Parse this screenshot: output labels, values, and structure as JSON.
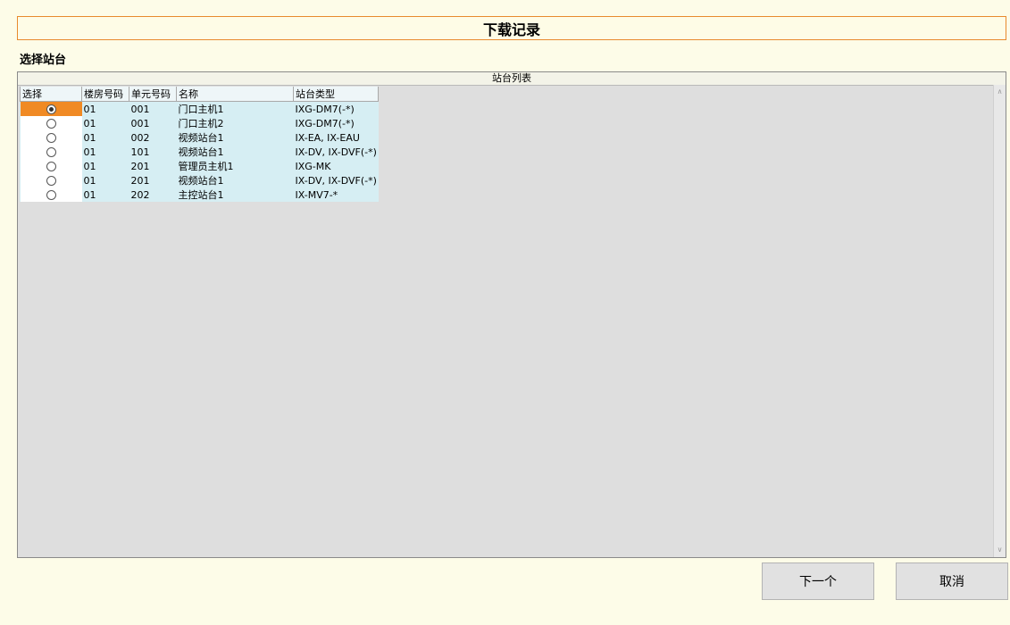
{
  "title": "下载记录",
  "section_label": "选择站台",
  "station_list": {
    "header": "站台列表",
    "columns": [
      "选择",
      "楼房号码",
      "单元号码",
      "名称",
      "站台类型"
    ],
    "selected_index": 0,
    "rows": [
      {
        "building": "01",
        "unit": "001",
        "name": "门口主机1",
        "type": "IXG-DM7(-*)"
      },
      {
        "building": "01",
        "unit": "001",
        "name": "门口主机2",
        "type": "IXG-DM7(-*)"
      },
      {
        "building": "01",
        "unit": "002",
        "name": "视频站台1",
        "type": "IX-EA, IX-EAU"
      },
      {
        "building": "01",
        "unit": "101",
        "name": "视频站台1",
        "type": "IX-DV, IX-DVF(-*)"
      },
      {
        "building": "01",
        "unit": "201",
        "name": "管理员主机1",
        "type": "IXG-MK"
      },
      {
        "building": "01",
        "unit": "201",
        "name": "视频站台1",
        "type": "IX-DV, IX-DVF(-*)"
      },
      {
        "building": "01",
        "unit": "202",
        "name": "主控站台1",
        "type": "IX-MV7-*"
      }
    ]
  },
  "buttons": {
    "next": "下一个",
    "cancel": "取消"
  }
}
